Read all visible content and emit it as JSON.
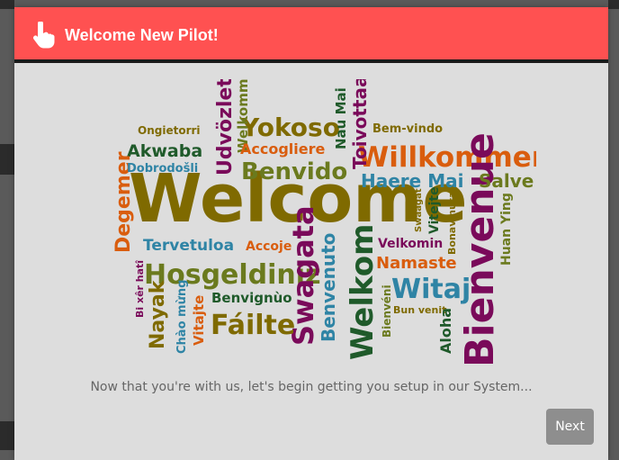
{
  "modal": {
    "title": "Welcome New Pilot!",
    "header_icon": "pointing-hand-icon",
    "header_color": "#ff5151",
    "intro_text": "Now that you're with us, let's begin getting you setup in our System...",
    "next_label": "Next"
  },
  "word_cloud": {
    "image": "welcome-word-cloud",
    "words": [
      "Welcome",
      "Willkommen",
      "Bienvenue",
      "Hosgeldiniz",
      "Yokoso",
      "Benvido",
      "Haere Mai",
      "Salve",
      "Akwaba",
      "Degemer",
      "Udvözlet",
      "Welkomma",
      "Nau Mai",
      "Toivottaa",
      "Bem-vindo",
      "Ongietorri",
      "Dobrodošli",
      "Accogliere",
      "Tervetuloa",
      "Accoje",
      "Swagata",
      "Benvenuto",
      "Welkom",
      "Velkomin",
      "Namaste",
      "Witaj",
      "Swaagat",
      "Vitejte",
      "Bonavinuta",
      "Huan Ying",
      "Bi xêr hatî",
      "Nayak",
      "Chào mừng",
      "Vitajte",
      "Benvignùo",
      "Fáilte",
      "Bienvéni",
      "Bun venit",
      "Aloha"
    ]
  }
}
